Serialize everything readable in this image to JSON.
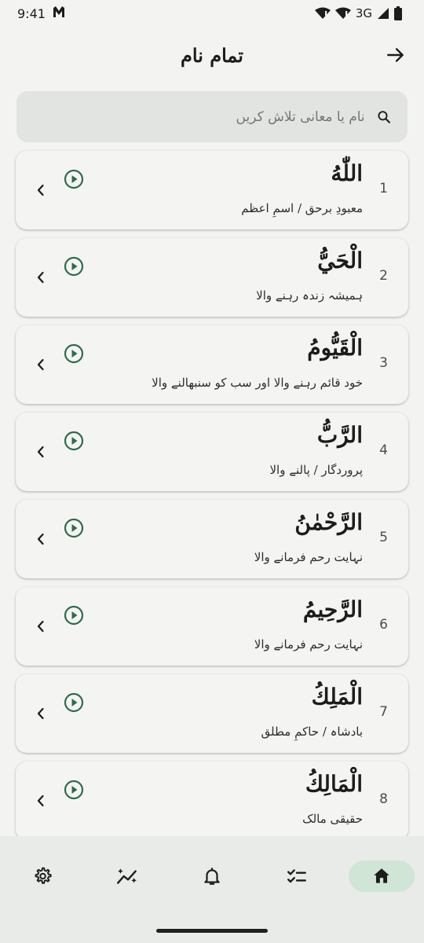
{
  "status": {
    "time": "9:41",
    "network": "3G"
  },
  "header": {
    "title": "تمام نام"
  },
  "search": {
    "placeholder": "نام یا معانی تلاش کریں"
  },
  "names": [
    {
      "number": "1",
      "arabic": "اللّٰهُ",
      "meaning": "معبودِ برحق / اسمِ اعظم"
    },
    {
      "number": "2",
      "arabic": "الْحَيُّ",
      "meaning": "ہمیشہ زندہ رہنے والا"
    },
    {
      "number": "3",
      "arabic": "الْقَيُّومُ",
      "meaning": "خود قائم رہنے والا اور سب کو سنبھالنے والا"
    },
    {
      "number": "4",
      "arabic": "الرَّبُّ",
      "meaning": "پروردگار / پالنے والا"
    },
    {
      "number": "5",
      "arabic": "الرَّحْمٰنُ",
      "meaning": "نہایت رحم فرمانے والا"
    },
    {
      "number": "6",
      "arabic": "الرَّحِيمُ",
      "meaning": "نہایت رحم فرمانے والا"
    },
    {
      "number": "7",
      "arabic": "الْمَلِكُ",
      "meaning": "بادشاہ / حاکمِ مطلق"
    },
    {
      "number": "8",
      "arabic": "الْمَالِكُ",
      "meaning": "حقیقی مالک"
    }
  ],
  "nav": {
    "items": [
      {
        "icon": "settings-icon"
      },
      {
        "icon": "sparkles-icon"
      },
      {
        "icon": "bell-icon"
      },
      {
        "icon": "checklist-icon"
      },
      {
        "icon": "home-icon",
        "active": true
      }
    ]
  },
  "colors": {
    "accent": "#2e6b4f",
    "active_nav_bg": "#cfe5d6",
    "background": "#f3f4f1"
  }
}
